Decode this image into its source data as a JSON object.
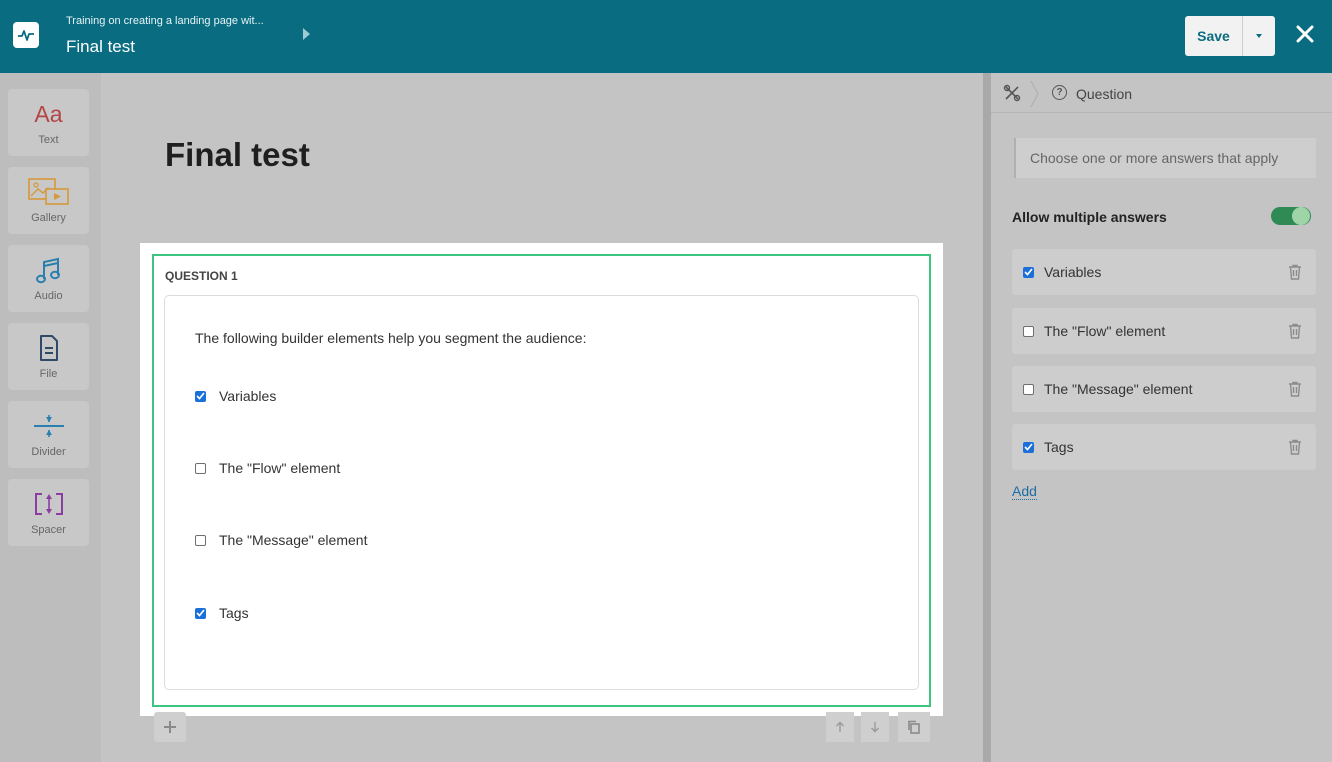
{
  "header": {
    "breadcrumb_parent": "Training on creating a landing page wit...",
    "title": "Final test",
    "save_label": "Save"
  },
  "toolbar": {
    "items": [
      {
        "label": "Text",
        "icon": "text-icon"
      },
      {
        "label": "Gallery",
        "icon": "gallery-icon"
      },
      {
        "label": "Audio",
        "icon": "audio-icon"
      },
      {
        "label": "File",
        "icon": "file-icon"
      },
      {
        "label": "Divider",
        "icon": "divider-icon"
      },
      {
        "label": "Spacer",
        "icon": "spacer-icon"
      }
    ],
    "text_icon_glyph": "Aa"
  },
  "canvas": {
    "page_title": "Final test",
    "question": {
      "label": "QUESTION 1",
      "text": "The following builder elements help you segment the audience:",
      "options": [
        {
          "label": "Variables",
          "checked": true
        },
        {
          "label": "The \"Flow\" element",
          "checked": false
        },
        {
          "label": "The \"Message\" element",
          "checked": false
        },
        {
          "label": "Tags",
          "checked": true
        }
      ]
    }
  },
  "panel": {
    "breadcrumb": "Question",
    "hint": "Choose one or more answers that apply",
    "allow_multiple_label": "Allow multiple answers",
    "allow_multiple": true,
    "answers": [
      {
        "label": "Variables",
        "checked": true
      },
      {
        "label": "The \"Flow\" element",
        "checked": false
      },
      {
        "label": "The \"Message\" element",
        "checked": false
      },
      {
        "label": "Tags",
        "checked": true
      }
    ],
    "add_label": "Add"
  },
  "colors": {
    "header_bg": "#0a6c80",
    "selection_border": "#3cc481",
    "checkbox_checked": "#1a6fd9",
    "toggle_on": "#2f8a54"
  }
}
